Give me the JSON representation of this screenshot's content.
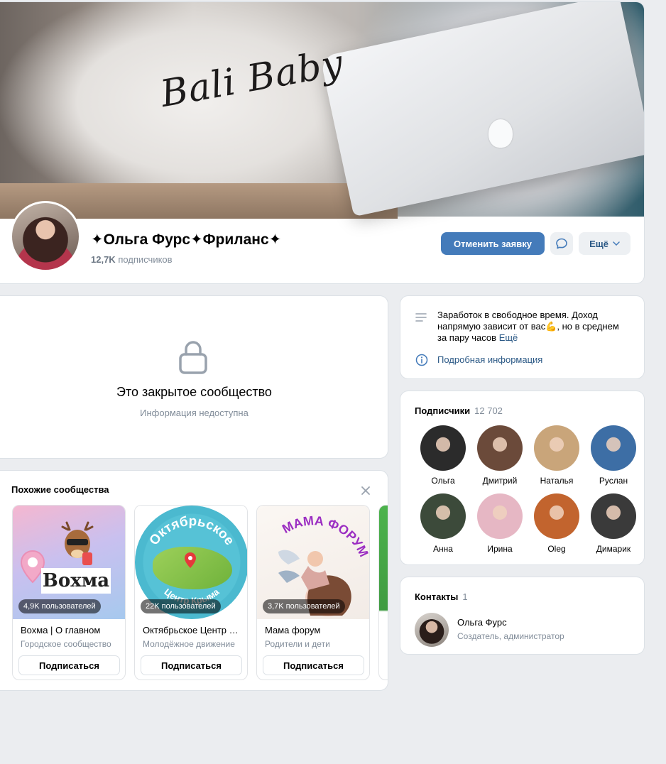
{
  "community": {
    "title": "✦Ольга Фурс✦Фриланс✦",
    "subscribers_count": "12,7K",
    "subscribers_label": "подписчиков",
    "cover_tshirt_text": "Bali Baby",
    "cancel_request_label": "Отменить заявку",
    "more_label": "Ещё"
  },
  "closed": {
    "title": "Это закрытое сообщество",
    "subtitle": "Информация недоступна"
  },
  "similar": {
    "heading": "Похожие сообщества",
    "items": [
      {
        "name": "Вохма | О главном",
        "desc": "Городское сообщество",
        "members": "4,9K пользователей",
        "subscribe_label": "Подписаться",
        "logo_text": "Вохма"
      },
      {
        "name": "Октябрьское Центр Крыма",
        "desc": "Молодёжное движение",
        "members": "22K пользователей",
        "subscribe_label": "Подписаться",
        "logo_text_top": "Октябрьское",
        "logo_text_bottom": "Центр Крыма"
      },
      {
        "name": "Мама форум",
        "desc": "Родители и дети",
        "members": "3,7K пользователей",
        "subscribe_label": "Подписаться",
        "logo_text": "МАМА ФОРУМ"
      }
    ]
  },
  "info": {
    "description": "Заработок в свободное время. Доход напрямую зависит от вас💪, но в среднем за пару часов",
    "more_label": "Ещё",
    "details_link": "Подробная информация"
  },
  "followers": {
    "heading": "Подписчики",
    "count": "12 702",
    "people": [
      {
        "name": "Ольга",
        "color": "#2b2b2b"
      },
      {
        "name": "Дмитрий",
        "color": "#6b4a3a"
      },
      {
        "name": "Наталья",
        "color": "#c9a57a"
      },
      {
        "name": "Руслан",
        "color": "#3d6ea5"
      },
      {
        "name": "Анна",
        "color": "#3c4a3a"
      },
      {
        "name": "Ирина",
        "color": "#e6b7c4"
      },
      {
        "name": "Oleg",
        "color": "#c2642e"
      },
      {
        "name": "Димарик",
        "color": "#3a3a3a"
      }
    ]
  },
  "contacts": {
    "heading": "Контакты",
    "count": "1",
    "name": "Ольга Фурс",
    "role": "Создатель, администратор"
  },
  "colors": {
    "accent": "#447bba",
    "link": "#2a5885",
    "muted": "#818c99",
    "background": "#ebedf0"
  }
}
